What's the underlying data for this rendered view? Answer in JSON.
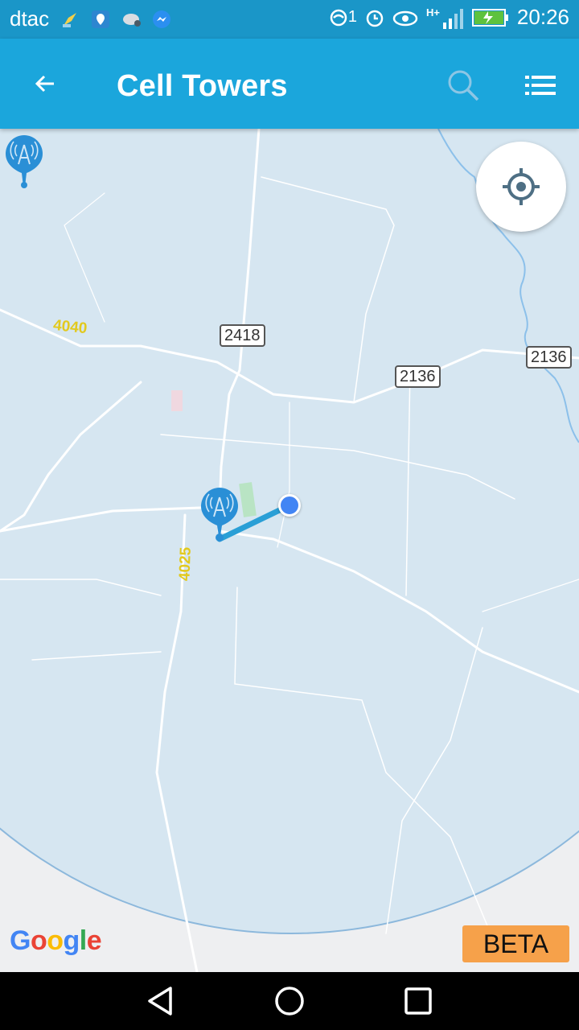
{
  "status_bar": {
    "carrier": "dtac",
    "sim_badge": "1",
    "network": "H+",
    "time": "20:26",
    "left_icons": [
      "cleaner-icon",
      "location-app-icon",
      "cloud-app-icon",
      "messenger-icon"
    ],
    "right_icons": [
      "sync-icon",
      "alarm-icon",
      "eye-icon",
      "signal-icon",
      "battery-charging-icon"
    ]
  },
  "app_bar": {
    "title": "Cell Towers",
    "back_icon": "arrow-left-icon",
    "search_icon": "search-icon",
    "menu_icon": "list-icon",
    "color": "#1ba6dc"
  },
  "map": {
    "road_labels": [
      "4040",
      "4025"
    ],
    "route_shields": [
      "2418",
      "2136",
      "2136"
    ],
    "coverage_color": "#d6e6f1",
    "tower_marker_color": "#2a8fd6",
    "user_location_color": "#4285f4",
    "attribution": [
      "G",
      "o",
      "o",
      "g",
      "l",
      "e"
    ]
  },
  "my_location_icon": "crosshair-icon",
  "beta_label": "BETA",
  "beta_color": "#f6a14a",
  "nav_bar": {
    "back_icon": "triangle-back-icon",
    "home_icon": "circle-home-icon",
    "recents_icon": "square-recents-icon"
  }
}
